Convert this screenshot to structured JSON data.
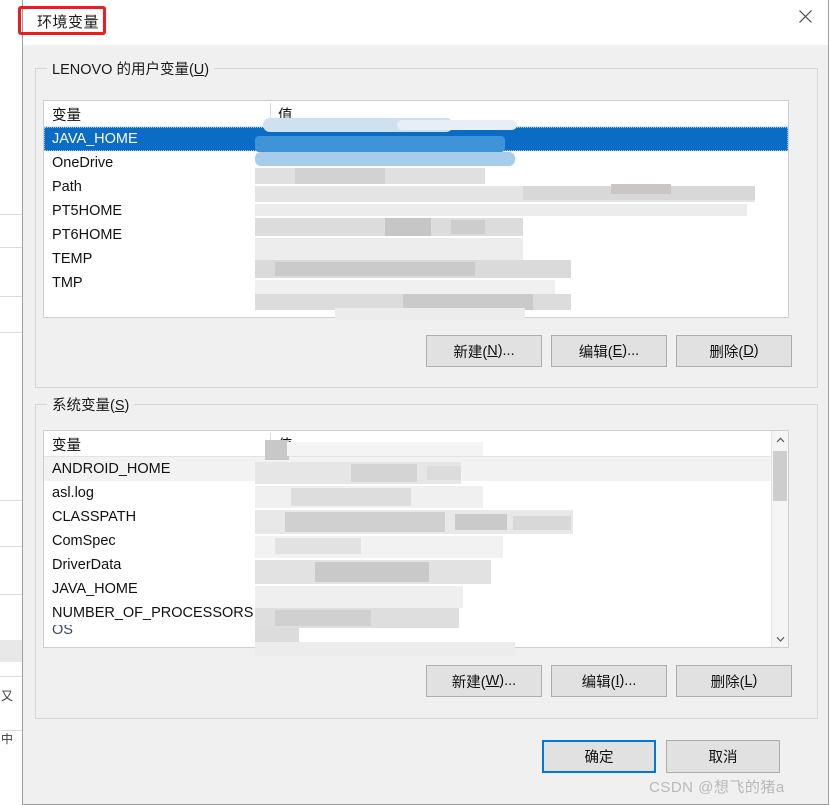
{
  "window": {
    "title": "环境变量",
    "close_icon": "close-icon"
  },
  "annotation": {
    "color": "#ee1c1c",
    "target": "环境变量"
  },
  "user_section": {
    "legend_prefix": "LENOVO 的用户变量(",
    "legend_accel": "U",
    "legend_suffix": ")",
    "columns": {
      "variable": "变量",
      "value": "值"
    },
    "rows": [
      {
        "name": "JAVA_HOME",
        "value": "",
        "state": "selected"
      },
      {
        "name": "OneDrive",
        "value": "",
        "state": "normal"
      },
      {
        "name": "Path",
        "value": "",
        "state": "normal"
      },
      {
        "name": "PT5HOME",
        "value": "",
        "state": "normal"
      },
      {
        "name": "PT6HOME",
        "value": "",
        "state": "normal"
      },
      {
        "name": "TEMP",
        "value": "",
        "state": "normal"
      },
      {
        "name": "TMP",
        "value": "",
        "state": "normal"
      }
    ],
    "buttons": {
      "new": {
        "pre": "新建(",
        "accel": "N",
        "post": ")..."
      },
      "edit": {
        "pre": "编辑(",
        "accel": "E",
        "post": ")..."
      },
      "delete": {
        "pre": "删除(",
        "accel": "D",
        "post": ")"
      }
    }
  },
  "system_section": {
    "legend_prefix": "系统变量(",
    "legend_accel": "S",
    "legend_suffix": ")",
    "columns": {
      "variable": "变量",
      "value": "值"
    },
    "rows": [
      {
        "name": "ANDROID_HOME",
        "value": "",
        "state": "hover"
      },
      {
        "name": "asl.log",
        "value": "",
        "state": "normal"
      },
      {
        "name": "CLASSPATH",
        "value": "",
        "state": "normal"
      },
      {
        "name": "ComSpec",
        "value": "",
        "state": "normal"
      },
      {
        "name": "DriverData",
        "value": "",
        "state": "normal"
      },
      {
        "name": "JAVA_HOME",
        "value": "",
        "state": "normal"
      },
      {
        "name": "NUMBER_OF_PROCESSORS",
        "value": "",
        "state": "normal"
      },
      {
        "name": "OS",
        "value": "",
        "state": "clipped"
      }
    ],
    "buttons": {
      "new": {
        "pre": "新建(",
        "accel": "W",
        "post": ")..."
      },
      "edit": {
        "pre": "编辑(",
        "accel": "I",
        "post": ")..."
      },
      "delete": {
        "pre": "删除(",
        "accel": "L",
        "post": ")"
      }
    },
    "scrollbar": {
      "up_icon": "chevron-up-icon",
      "down_icon": "chevron-down-icon"
    }
  },
  "footer": {
    "ok": "确定",
    "cancel": "取消"
  },
  "watermark": "CSDN @想飞的猪a",
  "colors": {
    "selection_blue": "#0a6cc4",
    "focus_blue": "#0078d7",
    "dialog_bg": "#f0f0f0",
    "annotation_red": "#ee1c1c"
  }
}
